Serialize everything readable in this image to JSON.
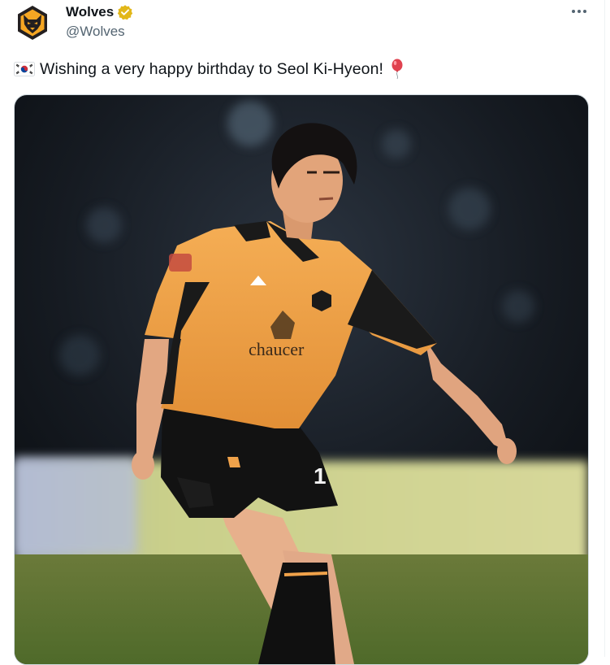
{
  "tweet": {
    "author_name": "Wolves",
    "author_handle": "@Wolves",
    "verified_badge": "gold-verified-icon",
    "text": "Wishing a very happy birthday to Seol Ki-Hyeon!",
    "emoji_prefix": "south-korea-flag-icon",
    "emoji_suffix": "balloon-icon",
    "more_menu": "more-options-icon"
  },
  "media": {
    "type": "photo",
    "kit_sponsor": "chaucer",
    "shorts_number": "1"
  },
  "colors": {
    "kit_orange": "#F0A24A",
    "verified_gold": "#E2B719",
    "handle_gray": "#536471"
  }
}
